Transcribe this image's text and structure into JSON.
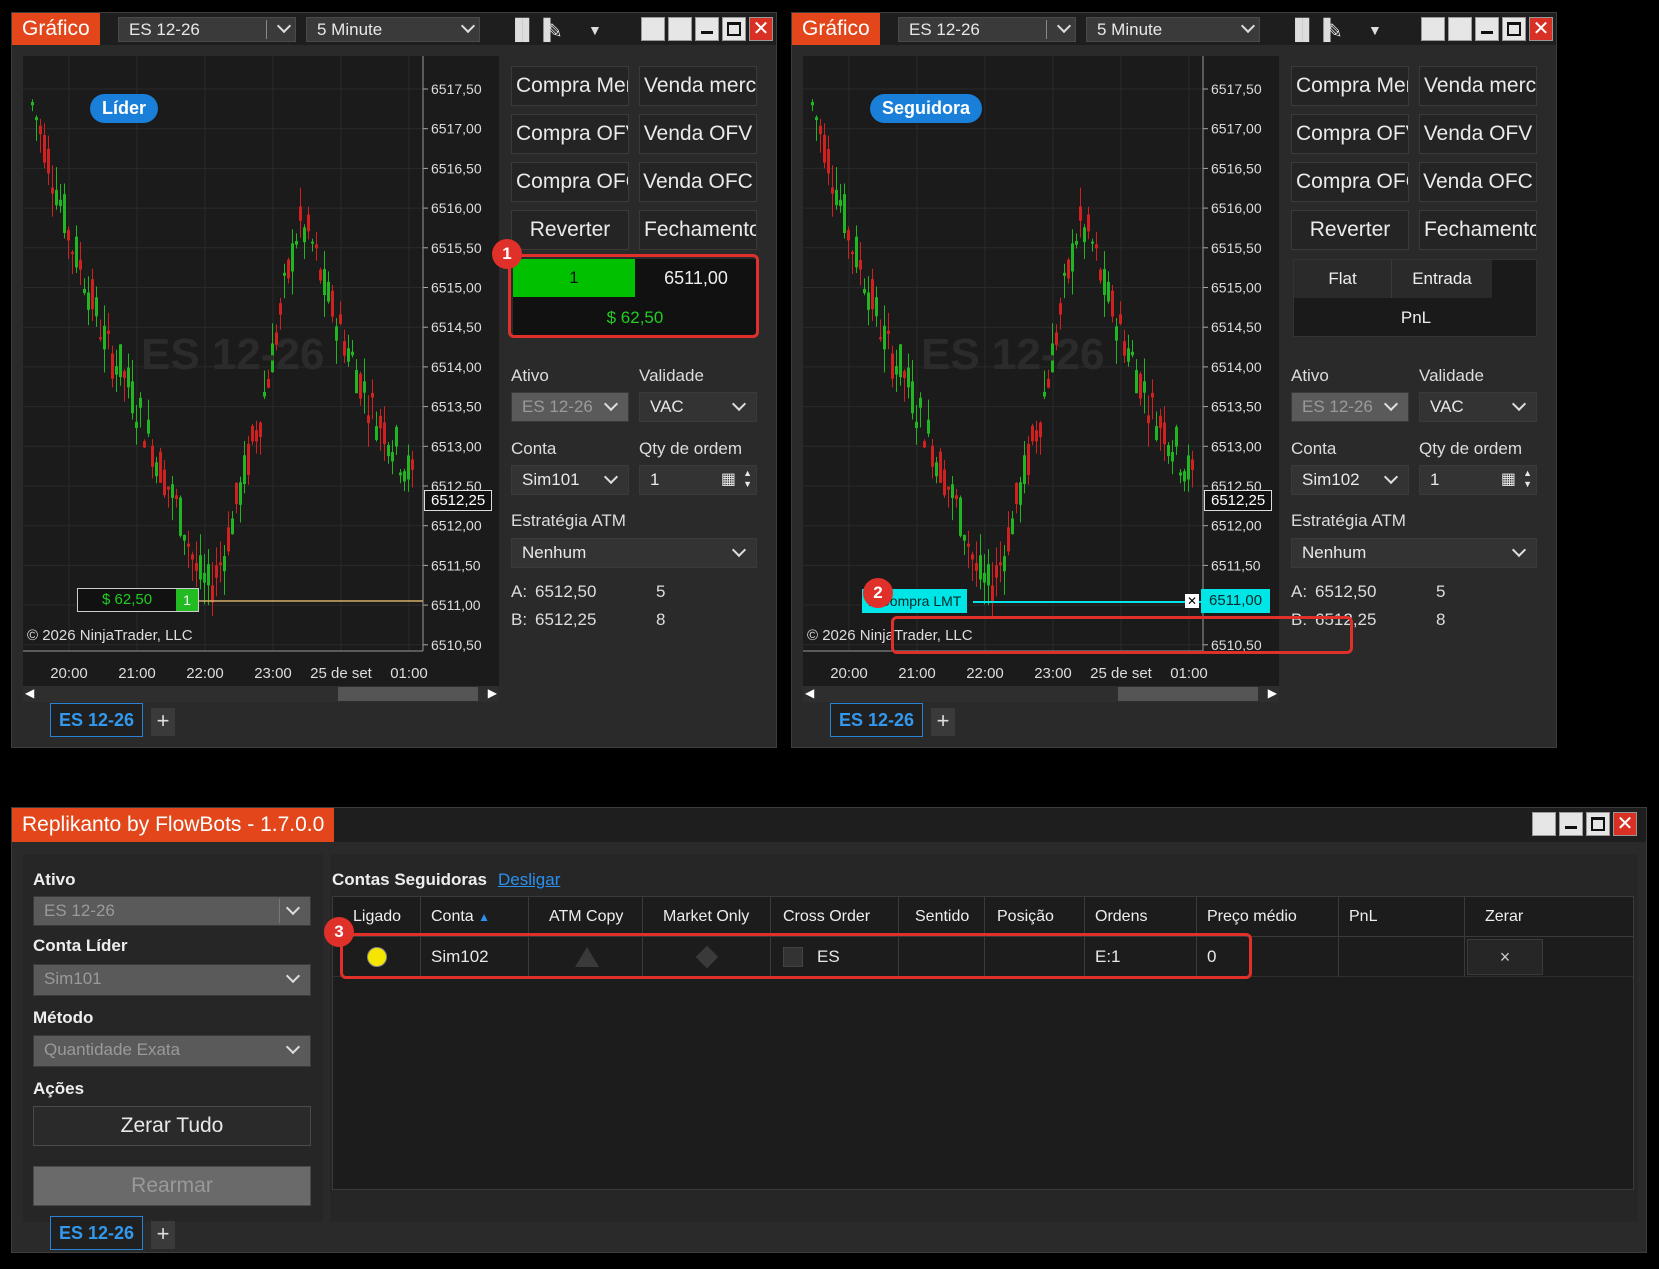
{
  "left_chart": {
    "title": "Gráfico",
    "instrument": "ES 12-26",
    "timeframe": "5 Minute",
    "role": "Líder",
    "watermark": "ES 12-26",
    "copyright": "© 2026 NinjaTrader, LLC",
    "price_flag": "6512,25",
    "position_pnl": "$ 62,50",
    "position_qty": "1",
    "bottom_tab": "ES 12-26",
    "chart_data": {
      "type": "candlestick",
      "y_ticks": [
        "6517,50",
        "6517,00",
        "6516,50",
        "6516,00",
        "6515,50",
        "6515,00",
        "6514,50",
        "6514,00",
        "6513,50",
        "6513,00",
        "6512,50",
        "6512,00",
        "6511,50",
        "6511,00",
        "6510,50"
      ],
      "x_ticks": [
        "20:00",
        "21:00",
        "22:00",
        "23:00",
        "25 de set",
        "01:00"
      ]
    }
  },
  "right_chart": {
    "title": "Gráfico",
    "instrument": "ES 12-26",
    "timeframe": "5 Minute",
    "role": "Seguidora",
    "watermark": "ES 12-26",
    "copyright": "© 2026 NinjaTrader, LLC",
    "price_flag": "6512,25",
    "order_label": "1 Compra LMT",
    "order_price": "6511,00",
    "bottom_tab": "ES 12-26"
  },
  "chart_trader": {
    "buttons": [
      "Compra Mer",
      "Venda merc",
      "Compra OFV",
      "Venda OFV",
      "Compra OFC",
      "Venda OFC",
      "Reverter",
      "Fechamento"
    ],
    "left_position": {
      "qty": "1",
      "price": "6511,00",
      "pnl": "$ 62,50"
    },
    "right_position": {
      "flat": "Flat",
      "entrada": "Entrada",
      "pnl": "PnL"
    },
    "ativo_label": "Ativo",
    "ativo_value": "ES 12-26",
    "validade_label": "Validade",
    "validade_value": "VAC",
    "conta_label": "Conta",
    "left_conta": "Sim101",
    "right_conta": "Sim102",
    "qty_label": "Qty de ordem",
    "qty_value": "1",
    "atm_label": "Estratégia ATM",
    "atm_value": "Nenhum",
    "ask_label": "A:",
    "ask_price": "6512,50",
    "ask_size": "5",
    "bid_label": "B:",
    "bid_price": "6512,25",
    "bid_size": "8"
  },
  "annotations": [
    "1",
    "2",
    "3"
  ],
  "replikanto": {
    "title": "Replikanto by FlowBots - 1.7.0.0",
    "ativo_label": "Ativo",
    "ativo_value": "ES 12-26",
    "lider_label": "Conta Líder",
    "lider_value": "Sim101",
    "metodo_label": "Método",
    "metodo_value": "Quantidade Exata",
    "acoes_label": "Ações",
    "zerar_tudo": "Zerar Tudo",
    "rearmar": "Rearmar",
    "followers_title": "Contas Seguidoras",
    "desligar": "Desligar",
    "columns": [
      "Ligado",
      "Conta",
      "ATM Copy",
      "Market Only",
      "Cross Order",
      "Sentido",
      "Posição",
      "Ordens",
      "Preço médio",
      "PnL",
      "Zerar"
    ],
    "row": {
      "conta": "Sim102",
      "cross": "ES",
      "ordens": "E:1",
      "preco_medio": "0",
      "zerar": "×"
    },
    "bottom_tab": "ES 12-26",
    "colors": {
      "on_indicator": "#f5e600"
    }
  }
}
